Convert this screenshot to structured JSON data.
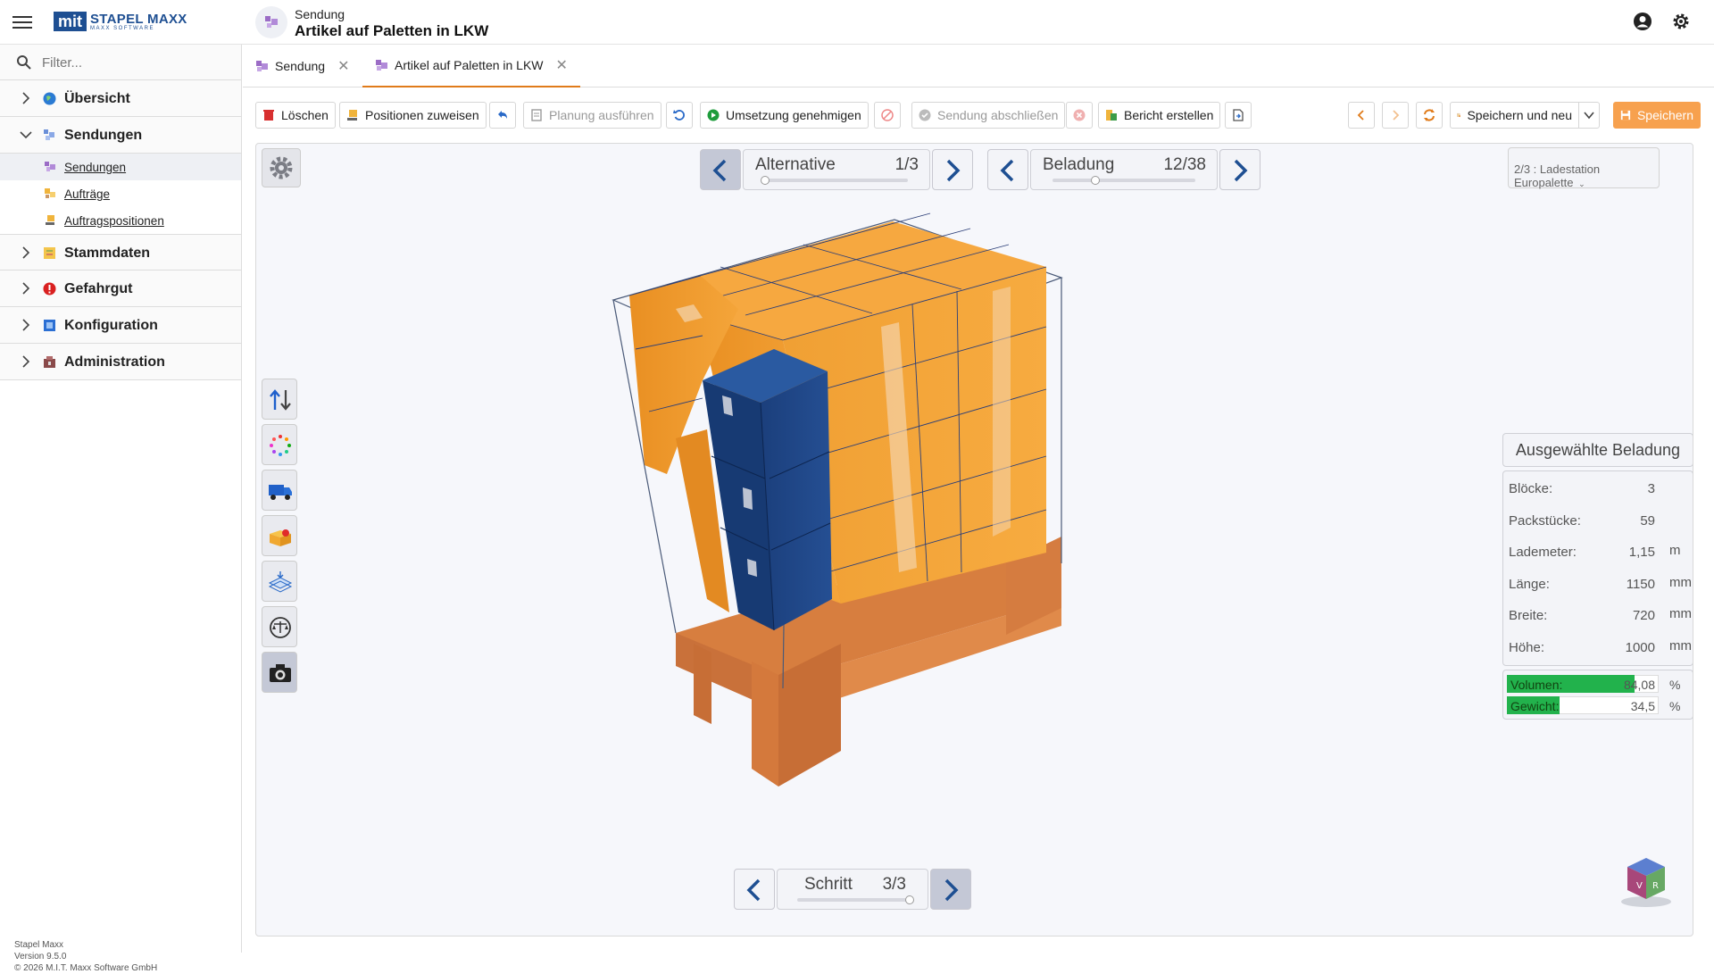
{
  "app": {
    "logo_mit": "mit",
    "logo_title": "STAPEL MAXX",
    "logo_sub": "MAXX SOFTWARE"
  },
  "header": {
    "context_label": "Sendung",
    "context_title": "Artikel auf Paletten in LKW"
  },
  "sidebar": {
    "filter_placeholder": "Filter...",
    "items": [
      {
        "label": "Übersicht",
        "expanded": false
      },
      {
        "label": "Sendungen",
        "expanded": true,
        "children": [
          {
            "label": "Sendungen",
            "active": true
          },
          {
            "label": "Aufträge"
          },
          {
            "label": "Auftragspositionen"
          }
        ]
      },
      {
        "label": "Stammdaten",
        "expanded": false
      },
      {
        "label": "Gefahrgut",
        "expanded": false
      },
      {
        "label": "Konfiguration",
        "expanded": false
      },
      {
        "label": "Administration",
        "expanded": false
      }
    ],
    "version": {
      "product": "Stapel Maxx",
      "version": "Version 9.5.0",
      "copyright": "© 2026 M.I.T. Maxx Software GmbH"
    }
  },
  "tabs": [
    {
      "label": "Sendung",
      "active": false
    },
    {
      "label": "Artikel auf Paletten in LKW",
      "active": true
    }
  ],
  "toolbar": {
    "delete": "Löschen",
    "assign": "Positionen zuweisen",
    "plan": "Planung ausführen",
    "approve": "Umsetzung genehmigen",
    "finish": "Sendung abschließen",
    "report": "Bericht erstellen",
    "save_new": "Speichern und neu",
    "save": "Speichern"
  },
  "viewer": {
    "alternative": {
      "label": "Alternative",
      "value": "1/3",
      "position": 0.0
    },
    "loading": {
      "label": "Beladung",
      "value": "12/38",
      "position": 0.3
    },
    "step": {
      "label": "Schritt",
      "value": "3/3",
      "position": 1.0
    },
    "station": "2/3 : Ladestation Europalette",
    "panel": {
      "title": "Ausgewählte Beladung",
      "rows": [
        {
          "key": "Blöcke:",
          "value": "3",
          "unit": ""
        },
        {
          "key": "Packstücke:",
          "value": "59",
          "unit": ""
        },
        {
          "key": "Lademeter:",
          "value": "1,15",
          "unit": "m"
        },
        {
          "key": "Länge:",
          "value": "1150",
          "unit": "mm"
        },
        {
          "key": "Breite:",
          "value": "720",
          "unit": "mm"
        },
        {
          "key": "Höhe:",
          "value": "1000",
          "unit": "mm"
        }
      ],
      "bars": [
        {
          "key": "Volumen:",
          "value": "84,08",
          "unit": "%",
          "fraction": 0.8408
        },
        {
          "key": "Gewicht:",
          "value": "34,5",
          "unit": "%",
          "fraction": 0.345
        }
      ]
    },
    "colors": {
      "box": "#f29b2c",
      "box_dark": "#d9861f",
      "blue": "#1f4c8f",
      "pallet": "#e08a4a",
      "accent": "#e07b1a"
    }
  }
}
